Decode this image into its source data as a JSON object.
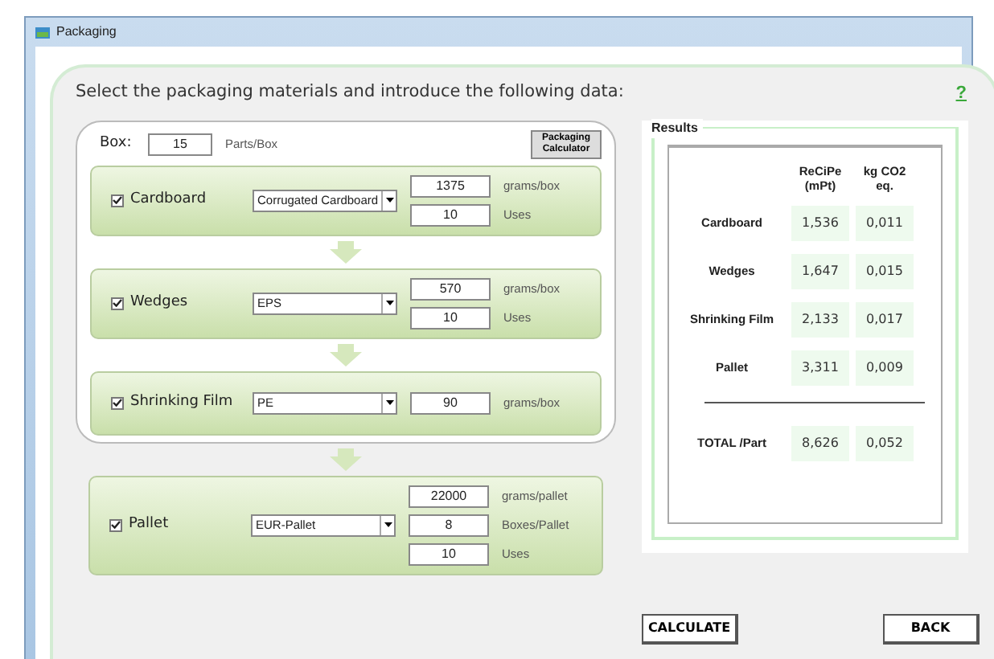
{
  "window": {
    "title": "Packaging"
  },
  "instruction": "Select the packaging materials and introduce the following data:",
  "help": "?",
  "box": {
    "label": "Box:",
    "value": "15",
    "unit": "Parts/Box",
    "calculator_button": "Packaging Calculator"
  },
  "materials": [
    {
      "name": "Cardboard",
      "checked": true,
      "material": "Corrugated Cardboard",
      "fields": [
        {
          "value": "1375",
          "unit": "grams/box"
        },
        {
          "value": "10",
          "unit": "Uses"
        }
      ]
    },
    {
      "name": "Wedges",
      "checked": true,
      "material": "EPS",
      "fields": [
        {
          "value": "570",
          "unit": "grams/box"
        },
        {
          "value": "10",
          "unit": "Uses"
        }
      ]
    },
    {
      "name": "Shrinking Film",
      "checked": true,
      "material": "PE",
      "fields": [
        {
          "value": "90",
          "unit": "grams/box"
        }
      ]
    }
  ],
  "pallet": {
    "name": "Pallet",
    "checked": true,
    "material": "EUR-Pallet",
    "fields": [
      {
        "value": "22000",
        "unit": "grams/pallet"
      },
      {
        "value": "8",
        "unit": "Boxes/Pallet"
      },
      {
        "value": "10",
        "unit": "Uses"
      }
    ]
  },
  "results": {
    "title": "Results",
    "columns": [
      "ReCiPe (mPt)",
      "kg CO2 eq."
    ],
    "rows": [
      {
        "label": "Cardboard",
        "values": [
          "1,536",
          "0,011"
        ]
      },
      {
        "label": "Wedges",
        "values": [
          "1,647",
          "0,015"
        ]
      },
      {
        "label": "Shrinking Film",
        "values": [
          "2,133",
          "0,017"
        ]
      },
      {
        "label": "Pallet",
        "values": [
          "3,311",
          "0,009"
        ]
      }
    ],
    "total": {
      "label": "TOTAL /Part",
      "values": [
        "8,626",
        "0,052"
      ]
    }
  },
  "buttons": [
    {
      "label": "CALCULATE"
    },
    {
      "label": "BACK"
    }
  ]
}
